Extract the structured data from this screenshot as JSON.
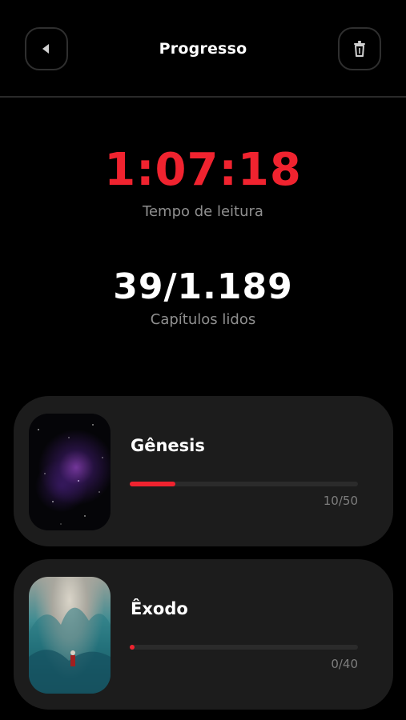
{
  "header": {
    "title": "Progresso",
    "back_icon": "back-arrow-icon",
    "delete_icon": "trash-icon"
  },
  "stats": {
    "reading_time": "1:07:18",
    "reading_time_label": "Tempo de leitura",
    "chapters_read": "39/1.189",
    "chapters_read_label": "Capítulos lidos"
  },
  "colors": {
    "accent": "#f0232f",
    "background": "#000000",
    "card": "#1c1c1c"
  },
  "books": [
    {
      "name": "Gênesis",
      "progress_text": "10/50",
      "progress": 0.2
    },
    {
      "name": "Êxodo",
      "progress_text": "0/40",
      "progress": 0.0
    }
  ]
}
